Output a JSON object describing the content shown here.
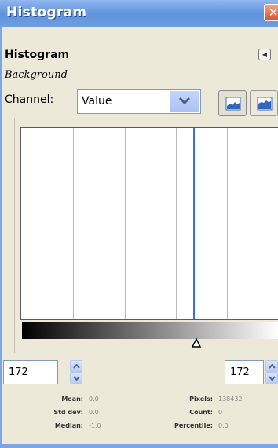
{
  "window": {
    "title": "Histogram",
    "close_glyph": "✕"
  },
  "dock": {
    "title": "Histogram",
    "drawable": "Background",
    "menu_icon": "tab-menu-icon"
  },
  "channel": {
    "label": "Channel:",
    "value": "Value"
  },
  "range": {
    "low": "172",
    "high": "172"
  },
  "stats": {
    "mean_label": "Mean:",
    "mean": "0.0",
    "stddev_label": "Std dev:",
    "stddev": "0.0",
    "median_label": "Median:",
    "median": "-1.0",
    "pixels_label": "Pixels:",
    "pixels": "138432",
    "count_label": "Count:",
    "count": "0",
    "percentile_label": "Percentile:",
    "percentile": "0.0"
  },
  "colors": {
    "titlebar": "#6e9fe4",
    "marker": "#3d6fd6",
    "background": "#ece9d8"
  }
}
